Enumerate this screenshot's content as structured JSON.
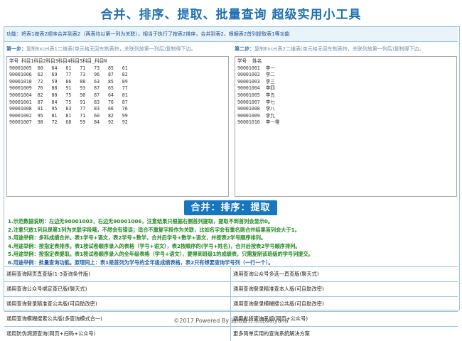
{
  "header": {
    "title": "合并、排序、提取、批量查询 超级实用小工具"
  },
  "function_bar": {
    "text": "功能：将表1按表2顺序合并到表2（两表均以第一列为关联），相当于执行了按表2排序，合并到表2，根据表2首列提取表1等功能"
  },
  "step1": {
    "label": "第一步：",
    "hint": "复制Excel表1二维表(单元格无回车制表符，关联列放第一列后)复制得下边。",
    "content": "学号 科目1科目2科目3科目4科目5科目_科目N\n90001005  60   64   61   71   73   85   61\n90001006  62   69   77   73   96   87   82\n90001010  72   59   86   88   63   85   89\n90001009  76   88   91   93   87   65   77\n90001004  82   80   75   90   87   64   81\n90001001  87   84   75   91   83   76   87\n90001008  91   95   83   77   83   66   76\n90001002  95   81   81   71   60   82   99\n90001007  98   72   68   59   84   92   92"
  },
  "step2": {
    "label": "第二步：",
    "hint": "复制Excel表2二维表(单元格无回车制表符，关联列放第一列后)复制得下边。",
    "content": "学号  姓名\n90001001  李一\n90001002  李二\n90001003  李三\n90001004  李四\n90001005  李五\n90001007  李七\n90001008  李八\n90001009  李九\n90001010  李一零"
  },
  "action_button": {
    "label": "合并：排序：提取"
  },
  "notes": [
    "1.示范数据说明：左边无90001003，右边无90001006，注意结果只根据右侧首列提取，提取不到首列会显示0。",
    "2.注意只放1列且是第1列为关联字段哦，不然会有错误；适合不重复字段作为关联，比如名字会有重名则合并结果首列会大于1。",
    "3.用途举例：多科成绩合并。表1学号+语文，表2学号+数学，合并后学号+数学+语文，并按表2学号顺序排列。",
    "4.用途举例：按指定表排序。表1按试卷顺序录入的表格（学号+语文），表2按顺序的(学号+姓名)，合并后按表2学号顺序排列。",
    "5.用途举例：按指定表提取。表1按试卷顺序录入的全年级表格（学号+语文），要得到班级1的成绩表，只需复制该班级的学号列提交。",
    "6.用途举例：批量查询功能。原理同上：表1是首列为学号的全年级成绩表格，表2只有想要查询学号列（一行一个）。"
  ],
  "links": [
    [
      "通用查询网页直查版(1-3查询条件版)",
      "通用查询公众号多选一直查版(聊天式)"
    ],
    [
      "通用查询公众号绑定查已版(聊天式)",
      "通用查询登录精准查本人版(可自助改密)"
    ],
    [
      "通用查询登录精准查公共版(可自助改密)",
      "通用查询登录模糊搜公共版(可自助改密)"
    ],
    [
      "通用查询模糊搜索公共版(多查询模式合一)",
      "通用发货查询系统(网页+公众号)"
    ],
    [
      "通用防伪溯源查询(网页+扫码+公众号)",
      "更多简单实用的查询系统解决方案"
    ]
  ],
  "footer": {
    "text": "©2017  Powered By 通用查分系统&alyaha"
  }
}
